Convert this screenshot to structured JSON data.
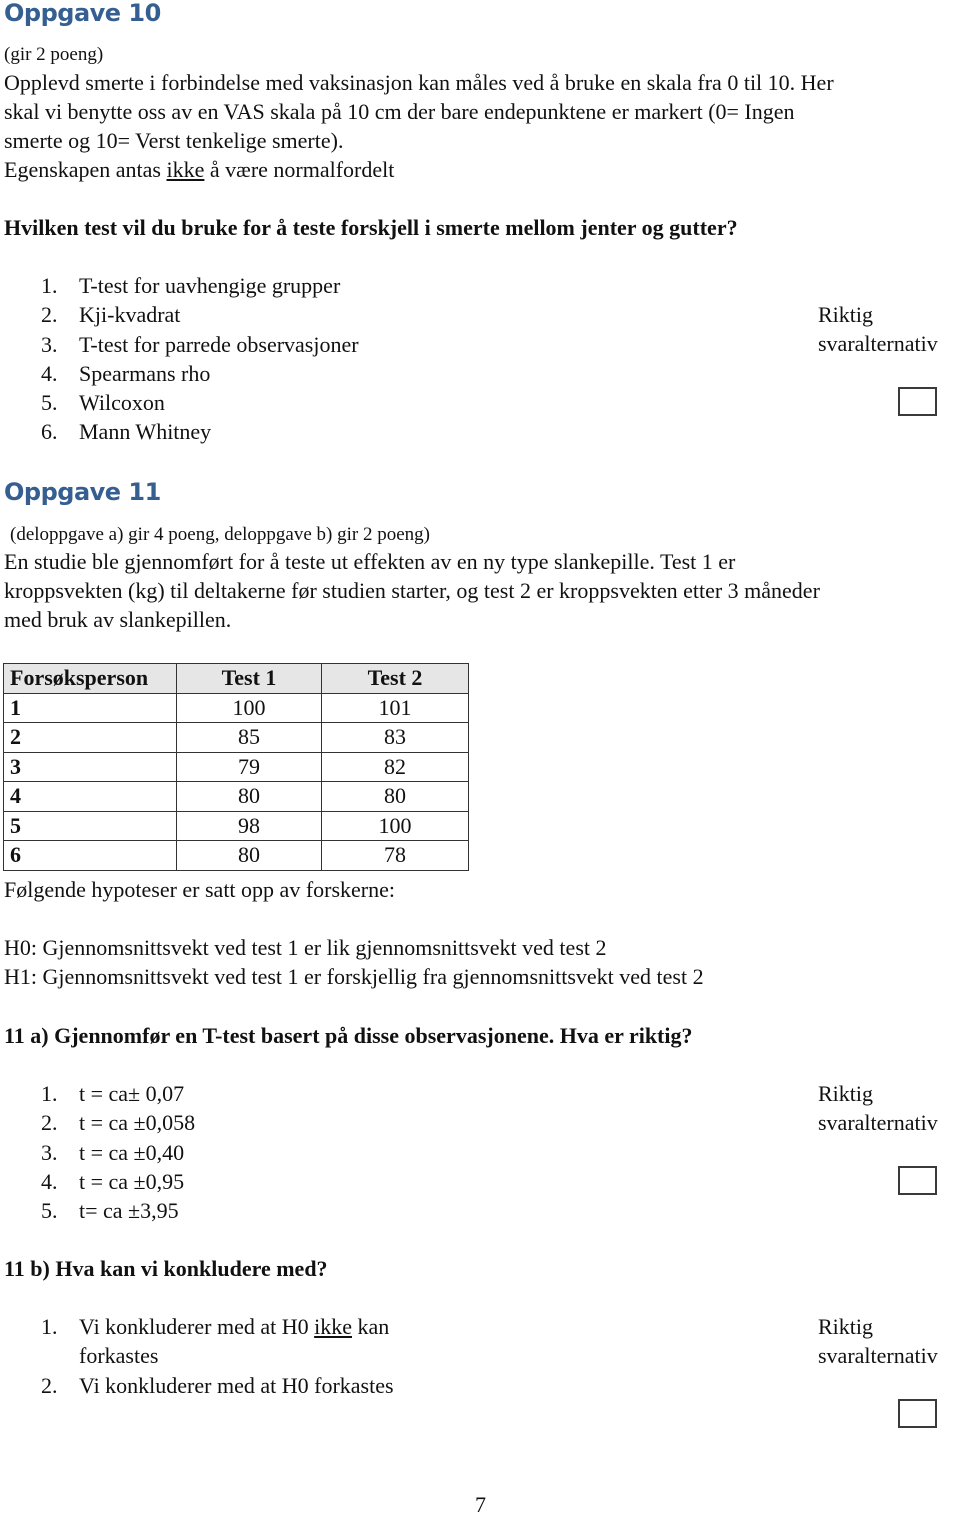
{
  "q10": {
    "heading": "Oppgave 10",
    "points": "(gir 2 poeng)",
    "intro_lines": [
      "Opplevd smerte i forbindelse med vaksinasjon kan måles ved å bruke en skala fra 0 til 10. Her",
      "skal vi benytte oss av en VAS skala på 10 cm der bare endepunktene er markert (0= Ingen",
      "smerte og 10= Verst tenkelige smerte)."
    ],
    "assumption_pre": "Egenskapen antas ",
    "assumption_underlined": "ikke",
    "assumption_post": " å være normalfordelt",
    "question": "Hvilken test vil du bruke for å teste forskjell i smerte mellom jenter og gutter?",
    "options": [
      {
        "num": "1.",
        "text": "T-test for uavhengige grupper"
      },
      {
        "num": "2.",
        "text": "Kji-kvadrat"
      },
      {
        "num": "3.",
        "text": "T-test for parrede observasjoner"
      },
      {
        "num": "4.",
        "text": "Spearmans rho"
      },
      {
        "num": "5.",
        "text": "Wilcoxon"
      },
      {
        "num": "6.",
        "text": "Mann Whitney"
      }
    ],
    "answer_label_1": "Riktig",
    "answer_label_2": "svaralternativ",
    "answer_value": ""
  },
  "q11": {
    "heading": "Oppgave 11",
    "points": "(deloppgave a) gir 4 poeng, deloppgave b) gir 2 poeng)",
    "intro_lines": [
      "En studie ble gjennomført for å teste ut effekten av en ny type slankepille. Test 1 er",
      "kroppsvekten (kg) til deltakerne før studien starter, og test 2 er kroppsvekten etter 3 måneder",
      "med bruk av slankepillen."
    ],
    "table": {
      "headers": [
        "Forsøksperson",
        "Test 1",
        "Test 2"
      ],
      "rows": [
        [
          "1",
          "100",
          "101"
        ],
        [
          "2",
          "85",
          "83"
        ],
        [
          "3",
          "79",
          "82"
        ],
        [
          "4",
          "80",
          "80"
        ],
        [
          "5",
          "98",
          "100"
        ],
        [
          "6",
          "80",
          "78"
        ]
      ]
    },
    "hypotheses_intro": "Følgende hypoteser er satt opp av forskerne:",
    "h0": "H0: Gjennomsnittsvekt ved test 1 er lik gjennomsnittsvekt ved test 2",
    "h1": "H1: Gjennomsnittsvekt ved test 1 er forskjellig fra gjennomsnittsvekt ved test 2",
    "part_a": {
      "question": "11 a) Gjennomfør en T-test basert på disse observasjonene.  Hva er riktig?",
      "options": [
        {
          "num": "1.",
          "text": "t = ca± 0,07"
        },
        {
          "num": "2.",
          "text": "t = ca ±0,058"
        },
        {
          "num": "3.",
          "text": "t = ca ±0,40"
        },
        {
          "num": "4.",
          "text": "t = ca ±0,95"
        },
        {
          "num": "5.",
          "text": "t= ca ±3,95"
        }
      ],
      "answer_label_1": "Riktig",
      "answer_label_2": "svaralternativ",
      "answer_value": ""
    },
    "part_b": {
      "question": "11 b) Hva kan vi konkludere med?",
      "option1_num": "1.",
      "option1_pre": "Vi konkluderer med at H0 ",
      "option1_underlined": "ikke",
      "option1_post": " kan",
      "option1_line2": "forkastes",
      "option2_num": "2.",
      "option2_text": "Vi konkluderer med at H0 forkastes",
      "answer_label_1": "Riktig",
      "answer_label_2": "svaralternativ",
      "answer_value": ""
    }
  },
  "page_number": "7"
}
